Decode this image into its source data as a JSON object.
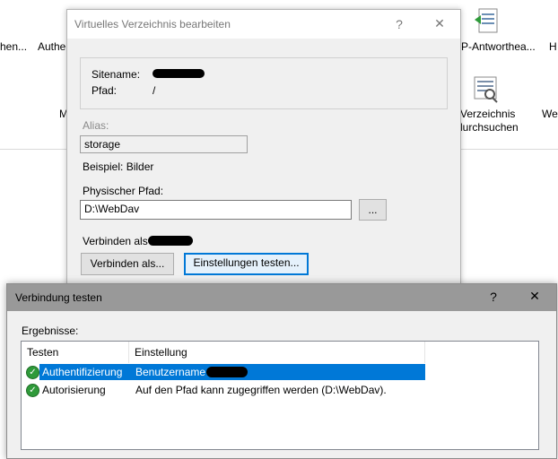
{
  "background": {
    "features_row1": [
      "hen...",
      "Authe",
      "P-Antworthea...",
      "H"
    ],
    "features_row2": [
      "M",
      "Verzeichnis",
      "durchsuchen",
      "We"
    ]
  },
  "dialog_vdir": {
    "title": "Virtuelles Verzeichnis bearbeiten",
    "help_label": "?",
    "close_label": "✕",
    "sitename_label": "Sitename:",
    "path_label": "Pfad:",
    "path_value": "/",
    "alias_label": "Alias:",
    "alias_value": "storage",
    "example_text": "Beispiel: Bilder",
    "physical_path_label": "Physischer Pfad:",
    "physical_path_value": "D:\\WebDav",
    "browse_button": "...",
    "connect_as_label": "Verbinden als",
    "connect_as_button": "Verbinden als...",
    "test_settings_button": "Einstellungen testen..."
  },
  "dialog_test": {
    "title": "Verbindung testen",
    "help_label": "?",
    "close_label": "✕",
    "results_label": "Ergebnisse:",
    "columns": [
      "Testen",
      "Einstellung"
    ],
    "rows": [
      {
        "test": "Authentifizierung",
        "setting": "Benutzername",
        "status": "success",
        "selected": true
      },
      {
        "test": "Autorisierung",
        "setting": "Auf den Pfad kann zugegriffen werden (D:\\WebDav).",
        "status": "success",
        "selected": false
      }
    ]
  }
}
